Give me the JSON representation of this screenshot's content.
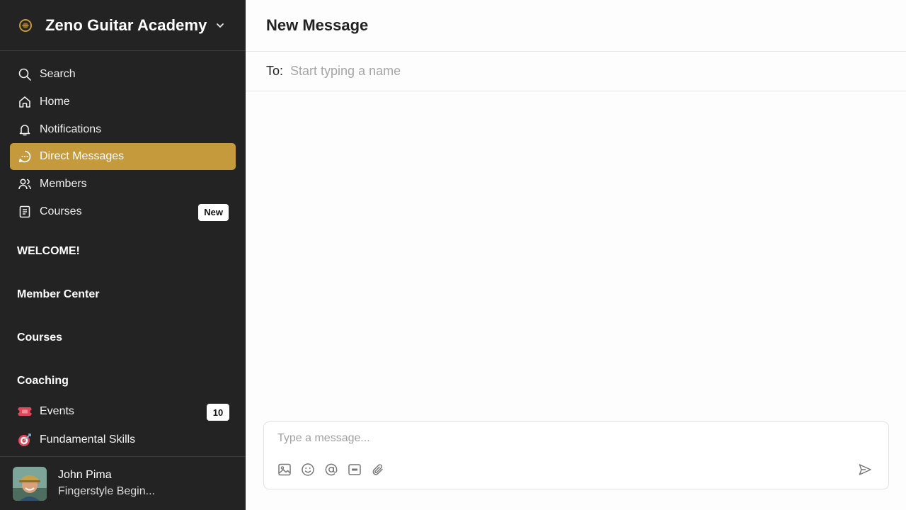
{
  "workspace": {
    "name": "Zeno Guitar Academy"
  },
  "nav": [
    {
      "label": "Search",
      "icon": "search-icon"
    },
    {
      "label": "Home",
      "icon": "home-icon"
    },
    {
      "label": "Notifications",
      "icon": "bell-icon"
    },
    {
      "label": "Direct Messages",
      "icon": "chat-icon",
      "active": true
    },
    {
      "label": "Members",
      "icon": "members-icon"
    },
    {
      "label": "Courses",
      "icon": "courses-icon",
      "badge": "New"
    }
  ],
  "sections": {
    "welcome": "WELCOME!",
    "member_center": "Member Center",
    "courses": "Courses",
    "coaching": "Coaching"
  },
  "spaces": [
    {
      "label": "Events",
      "icon": "ticket-icon",
      "count": "10"
    },
    {
      "label": "Fundamental Skills",
      "icon": "target-icon"
    }
  ],
  "profile": {
    "name": "John Pima",
    "subtitle": "Fingerstyle Begin..."
  },
  "main": {
    "title": "New Message",
    "to_label": "To:",
    "to_placeholder": "Start typing a name",
    "composer_placeholder": "Type a message..."
  },
  "colors": {
    "sidebar_bg": "#232323",
    "accent": "#c49a3c",
    "main_bg": "#fdfdfd"
  }
}
